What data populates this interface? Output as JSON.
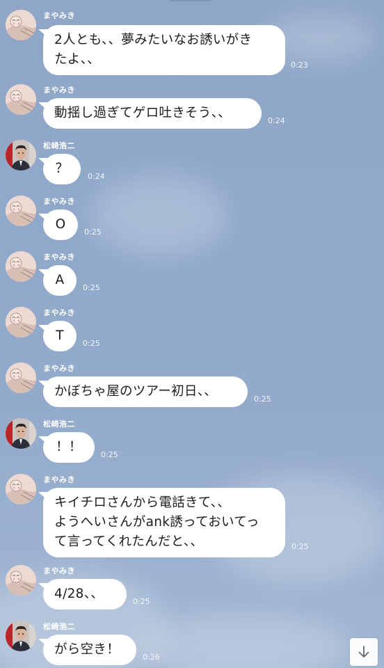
{
  "senders": {
    "mayamiki": "まやみき",
    "matsuzaki": "松崎浩二"
  },
  "messages": [
    {
      "sender": "まやみき",
      "avatar": "mayamiki",
      "text": "2人とも、、夢みたいなお誘いがき\nたよ、、",
      "time": "0:23"
    },
    {
      "sender": "まやみき",
      "avatar": "mayamiki",
      "text": "動揺し過ぎてゲロ吐きそう、、",
      "time": "0:24"
    },
    {
      "sender": "松崎浩二",
      "avatar": "matsuzaki",
      "text": "？",
      "time": "0:24"
    },
    {
      "sender": "まやみき",
      "avatar": "mayamiki",
      "text": "O",
      "time": "0:25"
    },
    {
      "sender": "まやみき",
      "avatar": "mayamiki",
      "text": "A",
      "time": "0:25"
    },
    {
      "sender": "まやみき",
      "avatar": "mayamiki",
      "text": "T",
      "time": "0:25"
    },
    {
      "sender": "まやみき",
      "avatar": "mayamiki",
      "text": "かぼちゃ屋のツアー初日、、",
      "time": "0:25"
    },
    {
      "sender": "松崎浩二",
      "avatar": "matsuzaki",
      "text": "！！",
      "time": "0:25"
    },
    {
      "sender": "まやみき",
      "avatar": "mayamiki",
      "text": "キイチロさんから電話きて、、\nようへいさんがank誘っておいてっ\nて言ってくれたんだと、、",
      "time": "0:25"
    },
    {
      "sender": "まやみき",
      "avatar": "mayamiki",
      "text": "4/28、、",
      "time": "0:25"
    },
    {
      "sender": "松崎浩二",
      "avatar": "matsuzaki",
      "text": "がら空き！",
      "time": "0:26"
    }
  ],
  "controls": {
    "scroll_down_icon": "arrow-down-icon"
  }
}
